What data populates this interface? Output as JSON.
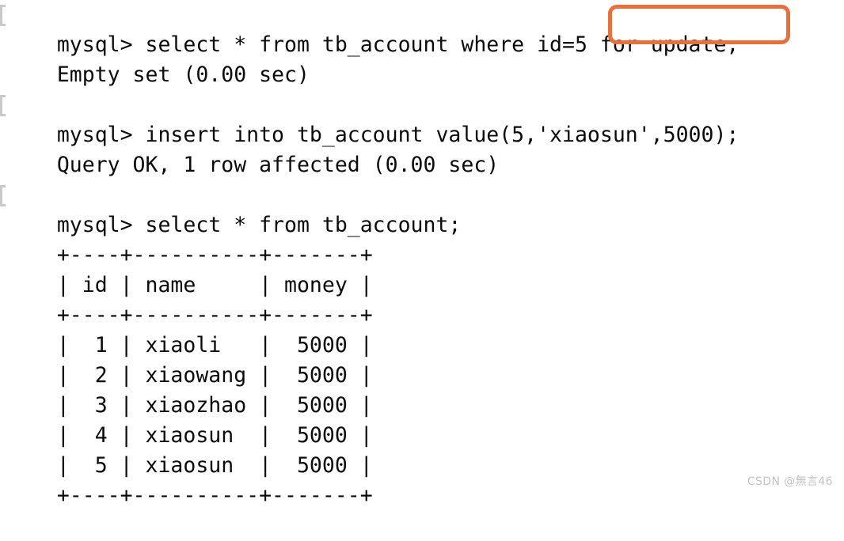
{
  "terminal": {
    "prompt": "mysql> ",
    "background_color": "#ffffff",
    "text_color": "#0b0b0b",
    "highlight_color": "#e8703c",
    "blocks": [
      {
        "command_prefix": "mysql> select * from tb_account where id=5 ",
        "command_highlighted": "for update;",
        "output": "Empty set (0.00 sec)"
      },
      {
        "command": "mysql> insert into tb_account value(5,'xiaosun',5000);",
        "output": "Query OK, 1 row affected (0.00 sec)"
      },
      {
        "command": "mysql> select * from tb_account;"
      }
    ],
    "table": {
      "border_top": "+----+----------+-------+",
      "header_row": "| id | name     | money |",
      "border_middle": "+----+----------+-------+",
      "rows": [
        "|  1 | xiaoli   |  5000 |",
        "|  2 | xiaowang |  5000 |",
        "|  3 | xiaozhao |  5000 |",
        "|  4 | xiaosun  |  5000 |",
        "|  5 | xiaosun  |  5000 |"
      ],
      "border_bottom": "+----+----------+-------+",
      "columns": [
        "id",
        "name",
        "money"
      ],
      "data": [
        {
          "id": "1",
          "name": "xiaoli",
          "money": "5000"
        },
        {
          "id": "2",
          "name": "xiaowang",
          "money": "5000"
        },
        {
          "id": "3",
          "name": "xiaozhao",
          "money": "5000"
        },
        {
          "id": "4",
          "name": "xiaosun",
          "money": "5000"
        },
        {
          "id": "5",
          "name": "xiaosun",
          "money": "5000"
        }
      ]
    }
  },
  "watermark": {
    "text": "CSDN @無言46"
  }
}
